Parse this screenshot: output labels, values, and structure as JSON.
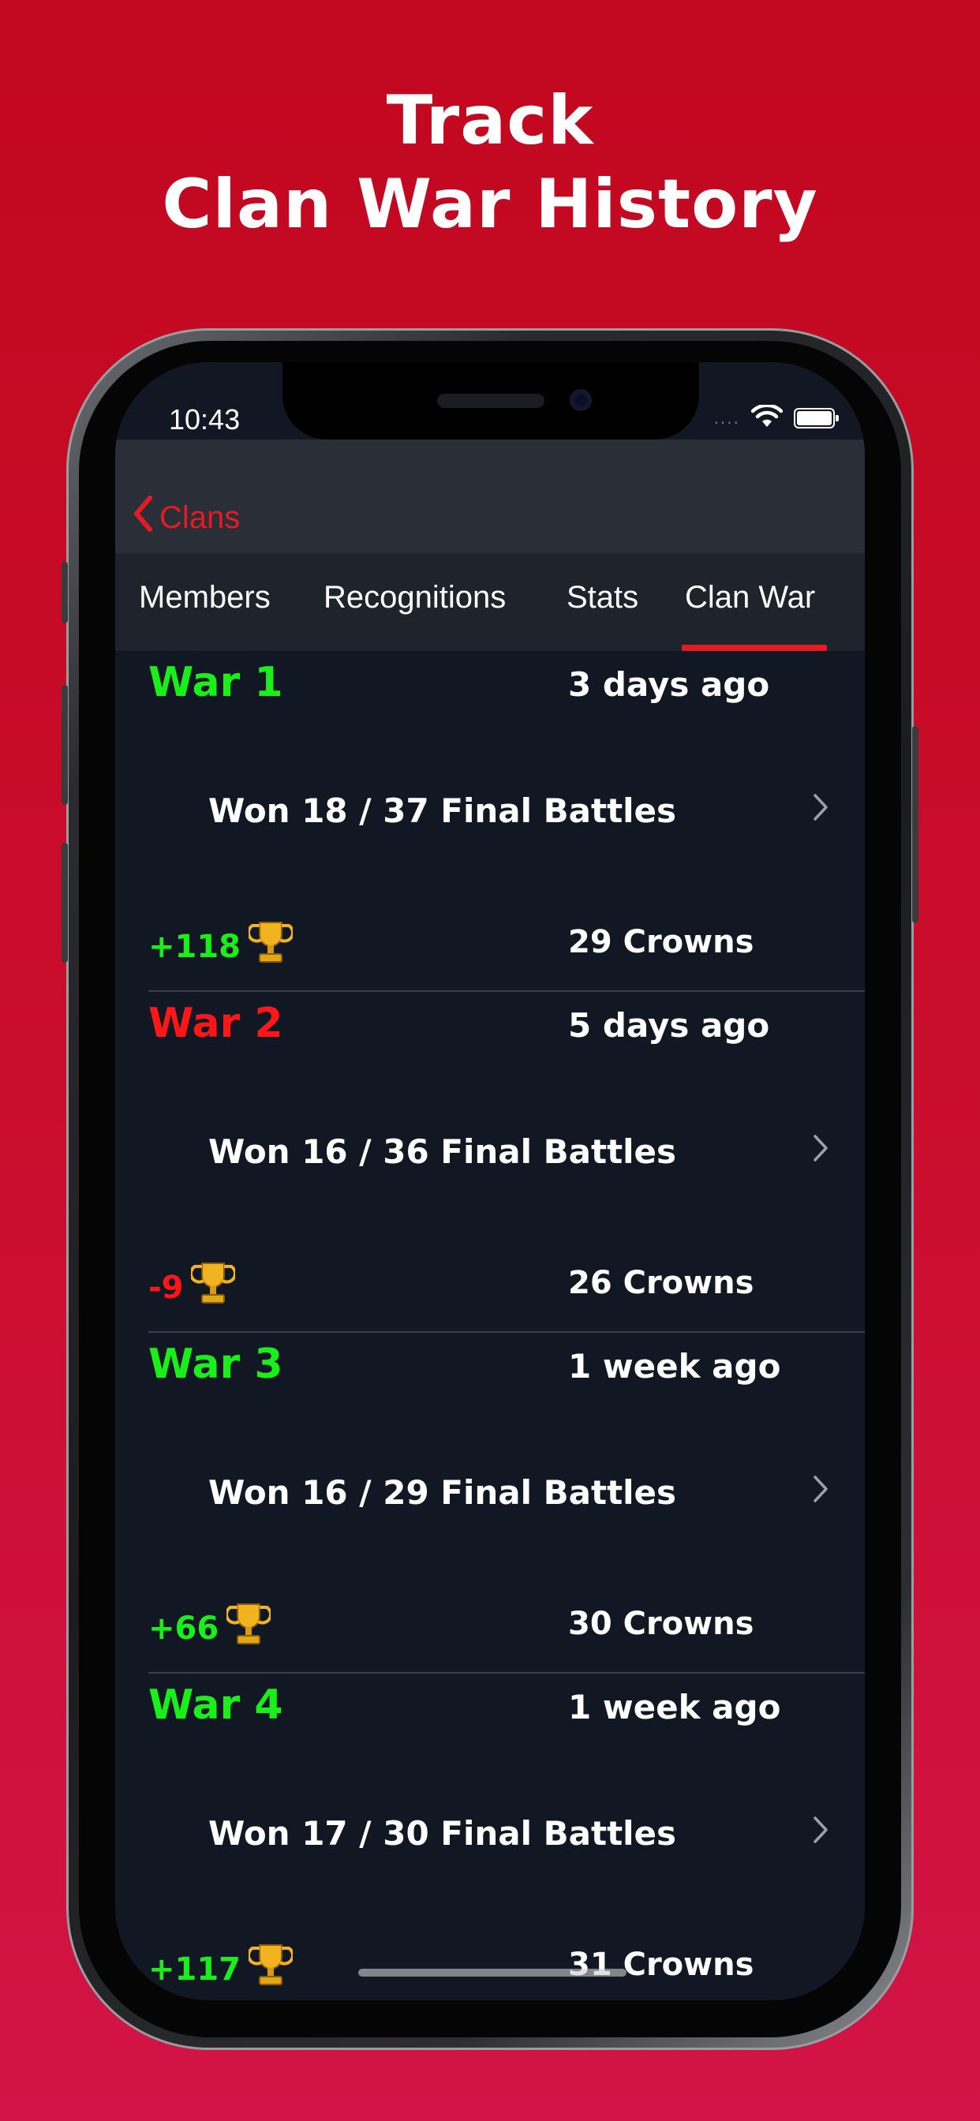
{
  "headline": {
    "line1": "Track",
    "line2": "Clan War History"
  },
  "status_bar": {
    "time": "10:43",
    "signal": "....",
    "wifi_icon": "wifi-icon",
    "battery_icon": "battery-icon"
  },
  "navigation": {
    "back_label": "Clans",
    "back_icon": "chevron-left-icon"
  },
  "tabs": [
    {
      "label": "Members"
    },
    {
      "label": "Recognitions"
    },
    {
      "label": "Stats"
    },
    {
      "label": "Clan War",
      "selected": true
    }
  ],
  "wars": [
    {
      "title": "War 1",
      "when": "3 days ago",
      "result": "Won 18 / 37 Final Battles",
      "trophies": "+118",
      "crowns": "29 Crowns",
      "status_color": "#19ef19"
    },
    {
      "title": "War 2",
      "when": "5 days ago",
      "result": "Won 16 / 36 Final Battles",
      "trophies": "-9",
      "crowns": "26 Crowns",
      "status_color": "#ff1616"
    },
    {
      "title": "War 3",
      "when": "1 week ago",
      "result": "Won 16 / 29 Final Battles",
      "trophies": "+66",
      "crowns": "30 Crowns",
      "status_color": "#19ef19"
    },
    {
      "title": "War 4",
      "when": "1 week ago",
      "result": "Won 17 / 30 Final Battles",
      "trophies": "+117",
      "crowns": "31 Crowns",
      "status_color": "#19ef19"
    }
  ],
  "colors": {
    "background_red": "#c90d2c",
    "accent_red": "#e51b23",
    "win_green": "#19ef19",
    "loss_red": "#ff1616",
    "list_background": "#111823"
  }
}
